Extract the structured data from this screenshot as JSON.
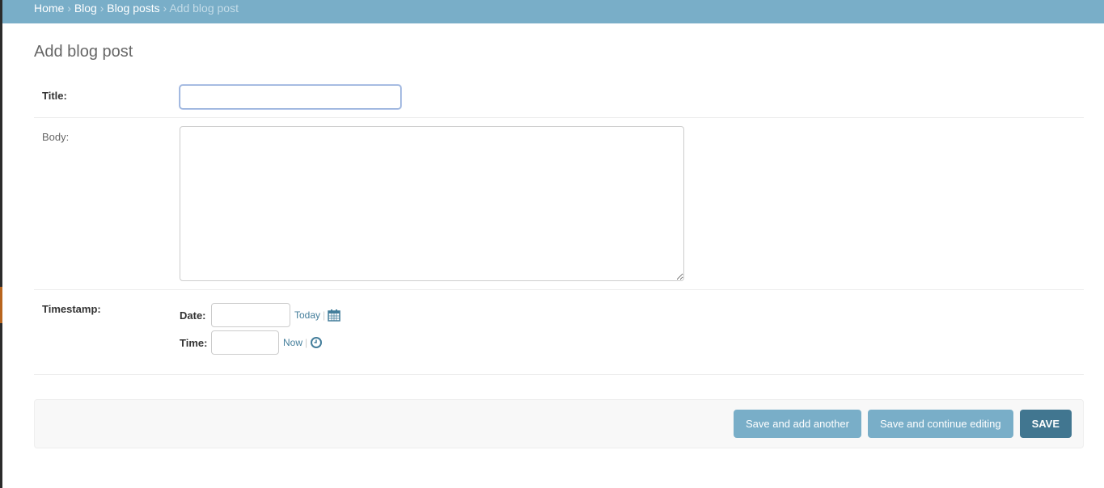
{
  "breadcrumbs": [
    {
      "label": "Home"
    },
    {
      "label": "Blog"
    },
    {
      "label": "Blog posts"
    }
  ],
  "breadcrumb_current": "Add blog post",
  "page_title": "Add blog post",
  "fields": {
    "title": {
      "label": "Title:",
      "value": ""
    },
    "body": {
      "label": "Body:",
      "value": ""
    },
    "timestamp": {
      "label": "Timestamp:",
      "date_label": "Date:",
      "date_value": "",
      "today": "Today",
      "time_label": "Time:",
      "time_value": "",
      "now": "Now"
    }
  },
  "buttons": {
    "save_add": "Save and add another",
    "save_continue": "Save and continue editing",
    "save": "Save"
  },
  "colors": {
    "header": "#79aec8",
    "button": "#79aec8",
    "default_button": "#417690",
    "link": "#447e9b"
  }
}
